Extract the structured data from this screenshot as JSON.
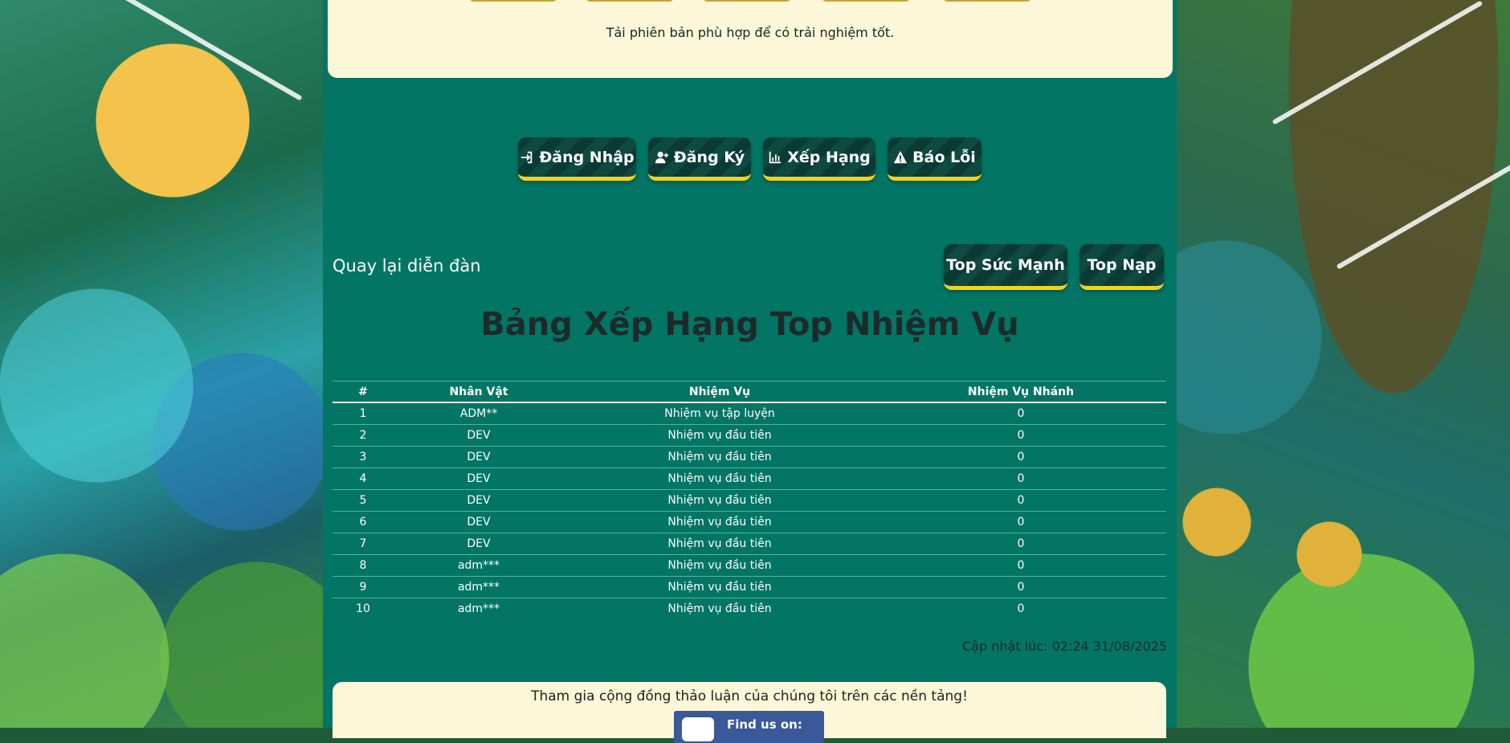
{
  "top_panel": {
    "hint": "Tải phiên bản phù hợp để có trải nghiệm tốt."
  },
  "nav_buttons": [
    {
      "label": "Đăng Nhập",
      "icon": "sign-in-icon"
    },
    {
      "label": "Đăng Ký",
      "icon": "user-plus-icon"
    },
    {
      "label": "Xếp Hạng",
      "icon": "bar-chart-icon"
    },
    {
      "label": "Báo Lỗi",
      "icon": "warning-icon"
    }
  ],
  "back_link": "Quay lại diễn đàn",
  "ranking_tabs": {
    "power": "Top Sức Mạnh",
    "topup": "Top Nạp"
  },
  "title": "Bảng Xếp Hạng Top Nhiệm Vụ",
  "table": {
    "headers": [
      "#",
      "Nhân Vật",
      "Nhiệm Vụ",
      "Nhiệm Vụ Nhánh"
    ],
    "rows": [
      [
        "1",
        "ADM**",
        "Nhiệm vụ tập luyện",
        "0"
      ],
      [
        "2",
        "DEV",
        "Nhiệm vụ đầu tiên",
        "0"
      ],
      [
        "3",
        "DEV",
        "Nhiệm vụ đầu tiên",
        "0"
      ],
      [
        "4",
        "DEV",
        "Nhiệm vụ đầu tiên",
        "0"
      ],
      [
        "5",
        "DEV",
        "Nhiệm vụ đầu tiên",
        "0"
      ],
      [
        "6",
        "DEV",
        "Nhiệm vụ đầu tiên",
        "0"
      ],
      [
        "7",
        "DEV",
        "Nhiệm vụ đầu tiên",
        "0"
      ],
      [
        "8",
        "adm***",
        "Nhiệm vụ đầu tiên",
        "0"
      ],
      [
        "9",
        "adm***",
        "Nhiệm vụ đầu tiên",
        "0"
      ],
      [
        "10",
        "adm***",
        "Nhiệm vụ đầu tiên",
        "0"
      ]
    ]
  },
  "updated": "Cập nhật lúc: 02:24 31/08/2025",
  "community": {
    "text": "Tham gia cộng đồng thảo luận của chúng tôi trên các nền tảng!",
    "facebook_label": "Find us on:"
  },
  "colors": {
    "center_bg": "#027565",
    "panel_bg": "#fcf7d8",
    "button_accent": "#f4d21a"
  }
}
